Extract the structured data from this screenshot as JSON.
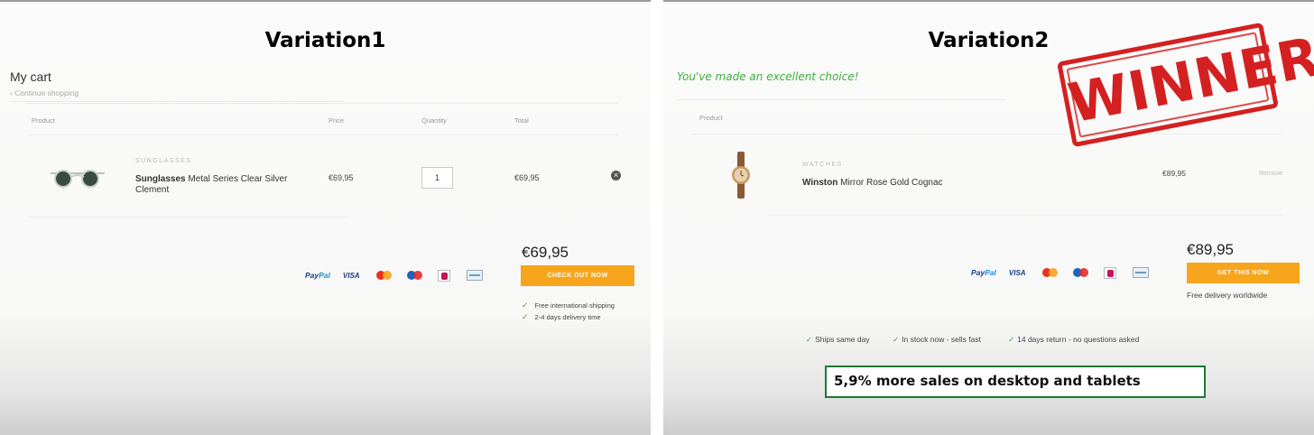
{
  "variation1": {
    "title": "Variation1",
    "cart_heading": "My cart",
    "continue_link": "‹ Continue shopping",
    "columns": {
      "product": "Product",
      "price": "Price",
      "quantity": "Quantity",
      "total": "Total"
    },
    "item": {
      "category": "SUNGLASSES",
      "name_bold": "Sunglasses",
      "name_rest": " Metal Series Clear Silver Clement",
      "price": "€69,95",
      "quantity": "1",
      "total": "€69,95",
      "remove_symbol": "×"
    },
    "grand_total": "€69,95",
    "checkout_label": "CHECK OUT NOW",
    "benefits": [
      "Free international shipping",
      "2-4 days delivery time"
    ],
    "payment": {
      "paypal_a": "Pay",
      "paypal_b": "Pal",
      "visa": "VISA"
    }
  },
  "variation2": {
    "title": "Variation2",
    "headline": "You've made an excellent choice!",
    "columns": {
      "product": "Product"
    },
    "item": {
      "category": "WATCHES",
      "name_bold": "Winston",
      "name_rest": " Mirror Rose Gold Cognac",
      "price": "€89,95",
      "remove_label": "Remove"
    },
    "grand_total": "€89,95",
    "cta_label": "GET THIS NOW",
    "delivery_note": "Free delivery worldwide",
    "usps": [
      "Ships same day",
      "In stock now - sells fast",
      "14 days return - no questions asked"
    ],
    "result": "5,9% more sales on desktop and tablets",
    "stamp": "WINNER",
    "payment": {
      "paypal_a": "Pay",
      "paypal_b": "Pal",
      "visa": "VISA"
    }
  },
  "colors": {
    "cta_orange": "#f7a51c",
    "stamp_red": "#d42020",
    "success_green": "#3fae3f",
    "box_green": "#1f7a33"
  },
  "icons": [
    "sunglasses-icon",
    "watch-icon",
    "remove-icon",
    "check-icon",
    "paypal-icon",
    "visa-icon",
    "mastercard-icon",
    "maestro-icon",
    "ideal-icon",
    "card-icon"
  ]
}
